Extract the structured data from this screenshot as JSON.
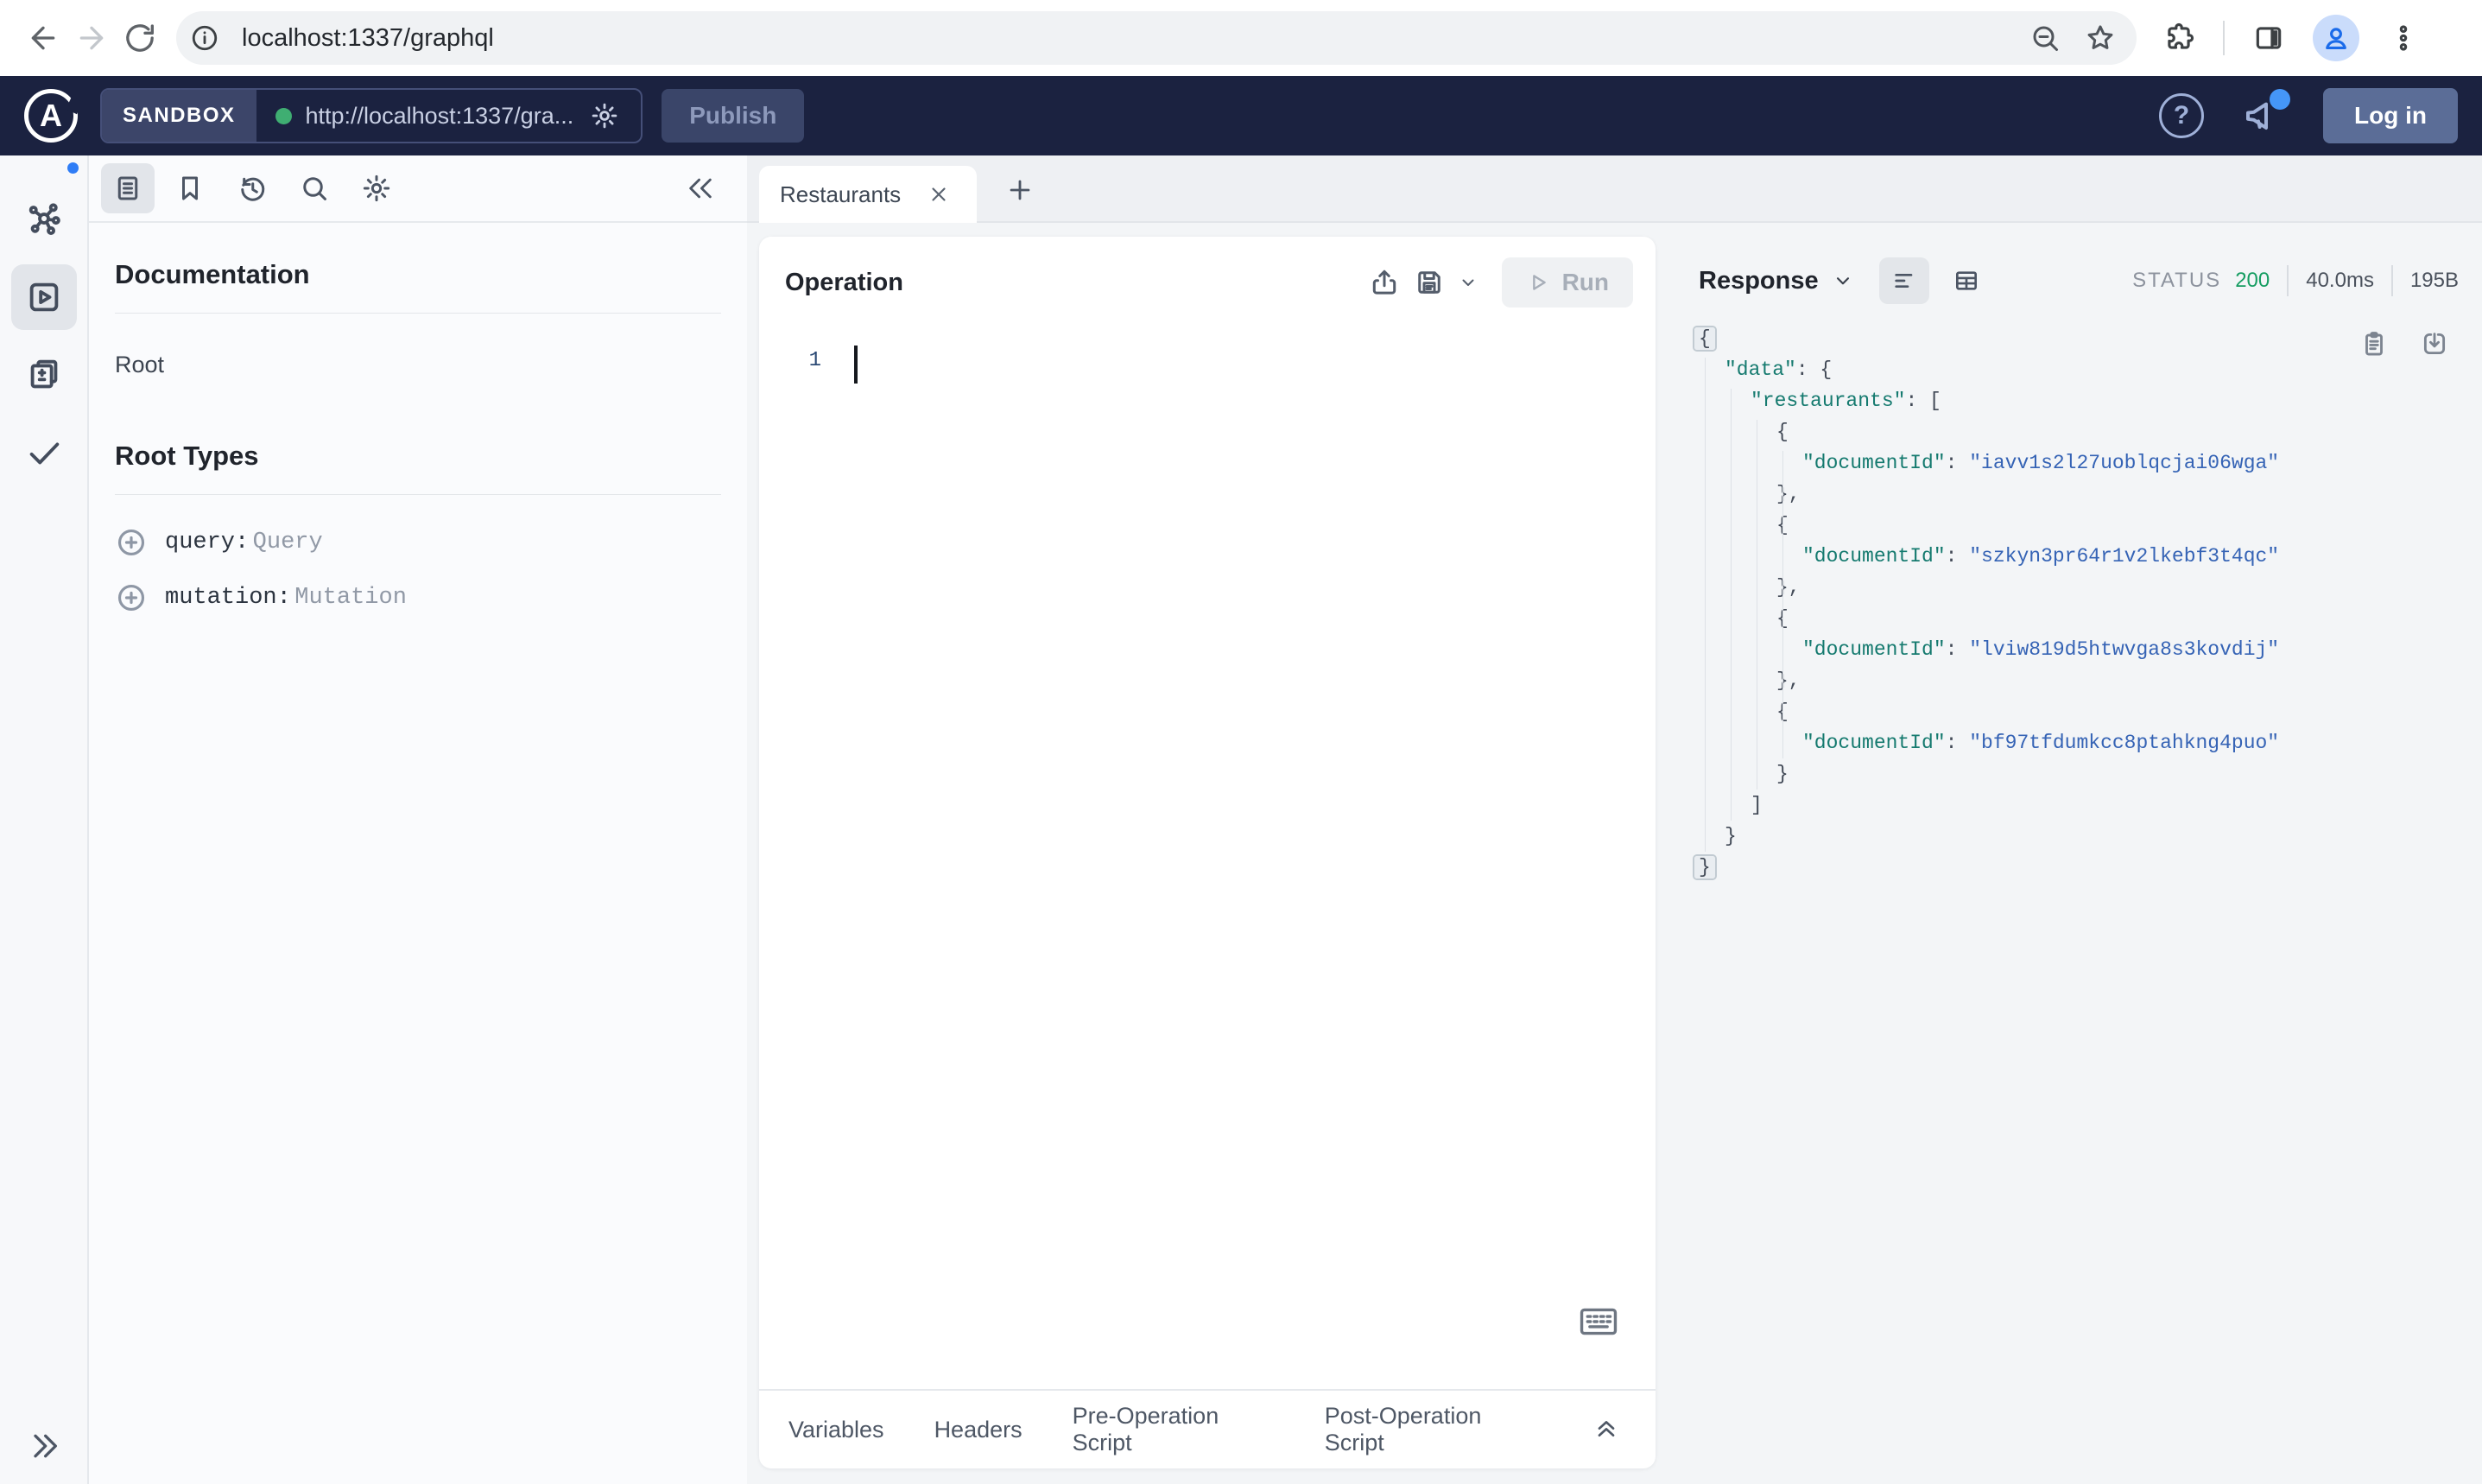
{
  "browser": {
    "url": "localhost:1337/graphql"
  },
  "toolbar": {
    "brand_letter": "A",
    "env_label": "SANDBOX",
    "endpoint_url": "http://localhost:1337/gra...",
    "publish_label": "Publish",
    "help_label": "?",
    "login_label": "Log in"
  },
  "docs": {
    "title": "Documentation",
    "root_link": "Root",
    "section_title": "Root Types",
    "root_types": [
      {
        "name": "query:",
        "type": "Query"
      },
      {
        "name": "mutation:",
        "type": "Mutation"
      }
    ]
  },
  "tabs": {
    "active_label": "Restaurants"
  },
  "operation": {
    "title": "Operation",
    "run_label": "Run",
    "line_number": "1",
    "footer_tabs": [
      "Variables",
      "Headers",
      "Pre-Operation Script",
      "Post-Operation Script"
    ]
  },
  "response": {
    "title": "Response",
    "status_label": "STATUS",
    "status_code": "200",
    "time": "40.0ms",
    "size": "195B",
    "lines": [
      {
        "ind": 0,
        "hl": true,
        "tk": [
          {
            "c": "p",
            "t": "{"
          }
        ]
      },
      {
        "ind": 1,
        "tk": [
          {
            "c": "k",
            "t": "\"data\""
          },
          {
            "c": "p",
            "t": ": {"
          }
        ]
      },
      {
        "ind": 2,
        "tk": [
          {
            "c": "k",
            "t": "\"restaurants\""
          },
          {
            "c": "p",
            "t": ": ["
          }
        ]
      },
      {
        "ind": 3,
        "tk": [
          {
            "c": "p",
            "t": "{"
          }
        ]
      },
      {
        "ind": 4,
        "tk": [
          {
            "c": "k",
            "t": "\"documentId\""
          },
          {
            "c": "p",
            "t": ": "
          },
          {
            "c": "v",
            "t": "\"iavv1s2l27uoblqcjai06wga\""
          }
        ]
      },
      {
        "ind": 3,
        "tk": [
          {
            "c": "p",
            "t": "},"
          }
        ]
      },
      {
        "ind": 3,
        "tk": [
          {
            "c": "p",
            "t": "{"
          }
        ]
      },
      {
        "ind": 4,
        "tk": [
          {
            "c": "k",
            "t": "\"documentId\""
          },
          {
            "c": "p",
            "t": ": "
          },
          {
            "c": "v",
            "t": "\"szkyn3pr64r1v2lkebf3t4qc\""
          }
        ]
      },
      {
        "ind": 3,
        "tk": [
          {
            "c": "p",
            "t": "},"
          }
        ]
      },
      {
        "ind": 3,
        "tk": [
          {
            "c": "p",
            "t": "{"
          }
        ]
      },
      {
        "ind": 4,
        "tk": [
          {
            "c": "k",
            "t": "\"documentId\""
          },
          {
            "c": "p",
            "t": ": "
          },
          {
            "c": "v",
            "t": "\"lviw819d5htwvga8s3kovdij\""
          }
        ]
      },
      {
        "ind": 3,
        "tk": [
          {
            "c": "p",
            "t": "},"
          }
        ]
      },
      {
        "ind": 3,
        "tk": [
          {
            "c": "p",
            "t": "{"
          }
        ]
      },
      {
        "ind": 4,
        "tk": [
          {
            "c": "k",
            "t": "\"documentId\""
          },
          {
            "c": "p",
            "t": ": "
          },
          {
            "c": "v",
            "t": "\"bf97tfdumkcc8ptahkng4puo\""
          }
        ]
      },
      {
        "ind": 3,
        "tk": [
          {
            "c": "p",
            "t": "}"
          }
        ]
      },
      {
        "ind": 2,
        "tk": [
          {
            "c": "p",
            "t": "]"
          }
        ]
      },
      {
        "ind": 1,
        "tk": [
          {
            "c": "p",
            "t": "}"
          }
        ]
      },
      {
        "ind": 0,
        "hl": true,
        "tk": [
          {
            "c": "p",
            "t": "}"
          }
        ]
      }
    ]
  },
  "colors": {
    "apollo_navy": "#1b2240",
    "status_green": "#169d62",
    "json_key_teal": "#157a6f",
    "json_value_blue": "#3563b5",
    "notification_blue": "#4596f7"
  },
  "icons": {
    "back": "arrow-left",
    "forward": "arrow-right",
    "reload": "circular-arrow",
    "site_info": "info-circle",
    "zoom": "magnifier-minus",
    "bookmark_star": "star",
    "extensions": "puzzle",
    "side_panel": "split-rect",
    "profile": "person",
    "menu": "three-dots",
    "schema": "network-graph",
    "explorer": "play-square",
    "changes": "doc-plus-minus",
    "checks": "checkmark",
    "keyboard": "keyboard"
  }
}
